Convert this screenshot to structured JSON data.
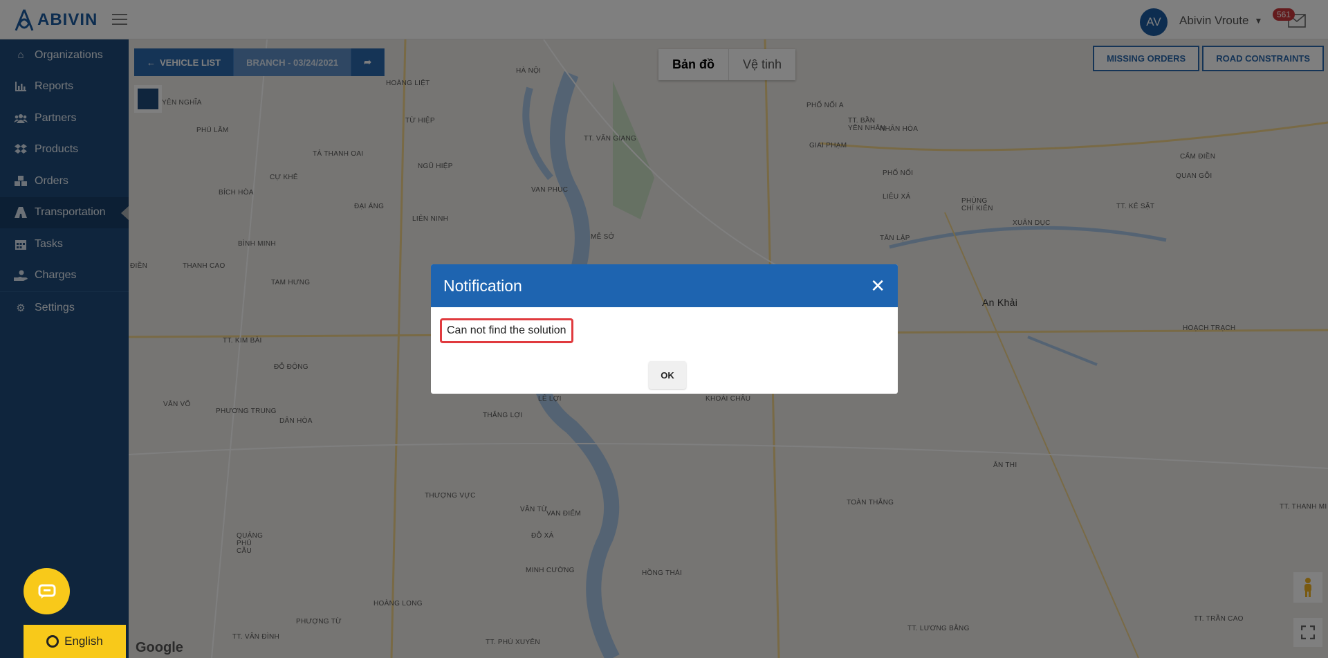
{
  "header": {
    "logo_text": "ABIVIN",
    "avatar_initials": "AV",
    "user_name": "Abivin Vroute",
    "notification_count": "561"
  },
  "sidebar": {
    "items": [
      {
        "label": "Organizations",
        "icon": "home-icon"
      },
      {
        "label": "Reports",
        "icon": "bar-chart-icon"
      },
      {
        "label": "Partners",
        "icon": "users-icon"
      },
      {
        "label": "Products",
        "icon": "dropbox-icon"
      },
      {
        "label": "Orders",
        "icon": "cubes-icon"
      },
      {
        "label": "Transportation",
        "icon": "road-icon",
        "active": true
      },
      {
        "label": "Tasks",
        "icon": "calendar-icon"
      },
      {
        "label": "Charges",
        "icon": "hand-money-icon"
      },
      {
        "label": "Settings",
        "icon": "gear-icon"
      }
    ],
    "language_label": "English"
  },
  "map": {
    "vehicle_list_label": "VEHICLE LIST",
    "branch_label": "BRANCH - 03/24/2021",
    "map_type_map": "Bản đồ",
    "map_type_satellite": "Vệ tinh",
    "missing_orders_label": "MISSING ORDERS",
    "road_constraints_label": "ROAD CONSTRAINTS",
    "google_label": "Google",
    "places": [
      "HÀ NỘI",
      "TỪ HIỆP",
      "TT. VĂN GIANG",
      "VAN PHUC",
      "NGŨ HIỆP",
      "ĐẠI ÁNG",
      "TẢ THANH OAI",
      "CỰ KHÊ",
      "BÍCH HÒA",
      "BÌNH MINH",
      "THANH CAO",
      "TAM HƯNG",
      "TT. KIM BÀI",
      "ĐỖ ĐỘNG",
      "PHƯƠNG TRUNG",
      "DÂN HÒA",
      "VÂN VÕ",
      "THẮNG LỢI",
      "LÊ LỢI",
      "KHOÁI CHÂU",
      "THƯỢNG VỰC",
      "VÂN TỪ",
      "VAN ĐIỂM",
      "ĐỖ XÁ",
      "MINH CƯỜNG",
      "HỒNG THÁI",
      "HOÀNG LONG",
      "PHƯỢNG TỪ",
      "TT. VÂN ĐÌNH",
      "TT. PHÚ XUYÊN",
      "QUẢNG PHÚ CẦU",
      "PHỐ NỐI A",
      "TT. BẦN YÊN NHÂN",
      "NHÂN HÒA",
      "GIAI PHẠM",
      "PHỐ NỐI",
      "LIÊU XÁ",
      "PHÙNG CHÍ KIÊN",
      "XUÂN DỤC",
      "TÂN LẬP",
      "An Khải",
      "ÂN THI",
      "TOÀN THẮNG",
      "HOÀNG LIỆT",
      "YÊN NGHĨA",
      "PHÚ LÃM",
      "LIÊN NINH",
      "MỄ SỞ",
      "CẨM ĐIỀN",
      "QUAN GỖI",
      "TT. KẺ SẶT",
      "HOẠCH TRẠCH",
      "TT. THANH MI",
      "TT. TRẦN CAO",
      "TT. LƯƠNG BẰNG",
      "ĐIỀN"
    ]
  },
  "modal": {
    "title": "Notification",
    "message": "Can not find the solution",
    "ok_label": "OK"
  }
}
